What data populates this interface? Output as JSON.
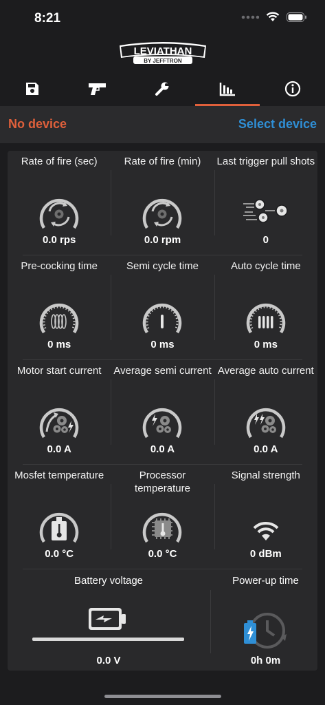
{
  "status": {
    "time": "8:21"
  },
  "logo": {
    "main": "LEVIATHAN",
    "sub": "BY JEFFTRON"
  },
  "tabs": [
    {
      "icon": "save-icon"
    },
    {
      "icon": "gun-icon"
    },
    {
      "icon": "wrench-icon"
    },
    {
      "icon": "stats-icon",
      "active": true
    },
    {
      "icon": "info-icon"
    }
  ],
  "device": {
    "status": "No device",
    "select_label": "Select device"
  },
  "metrics": [
    {
      "title": "Rate of fire (sec)",
      "value": "0.0 rps",
      "icon": "rate-gauge-icon"
    },
    {
      "title": "Rate of fire (min)",
      "value": "0.0 rpm",
      "icon": "rate-gauge-icon"
    },
    {
      "title": "Last trigger pull shots",
      "value": "0",
      "icon": "bullets-icon"
    },
    {
      "title": "Pre-cocking time",
      "value": "0 ms",
      "icon": "spring-gauge-icon"
    },
    {
      "title": "Semi cycle time",
      "value": "0 ms",
      "icon": "semi-gauge-icon"
    },
    {
      "title": "Auto cycle time",
      "value": "0 ms",
      "icon": "auto-gauge-icon"
    },
    {
      "title": "Motor start current",
      "value": "0.0 A",
      "icon": "motor-current-icon"
    },
    {
      "title": "Average semi current",
      "value": "0.0 A",
      "icon": "semi-current-icon"
    },
    {
      "title": "Average auto current",
      "value": "0.0 A",
      "icon": "auto-current-icon"
    },
    {
      "title": "Mosfet temperature",
      "value": "0.0 °C",
      "icon": "mosfet-temp-icon"
    },
    {
      "title": "Processor temperature",
      "value": "0.0 °C",
      "icon": "cpu-temp-icon"
    },
    {
      "title": "Signal strength",
      "value": "0 dBm",
      "icon": "wifi-icon"
    }
  ],
  "battery": {
    "title": "Battery voltage",
    "value": "0.0 V",
    "level": 0
  },
  "powerup": {
    "title": "Power-up time",
    "value": "0h 0m"
  }
}
